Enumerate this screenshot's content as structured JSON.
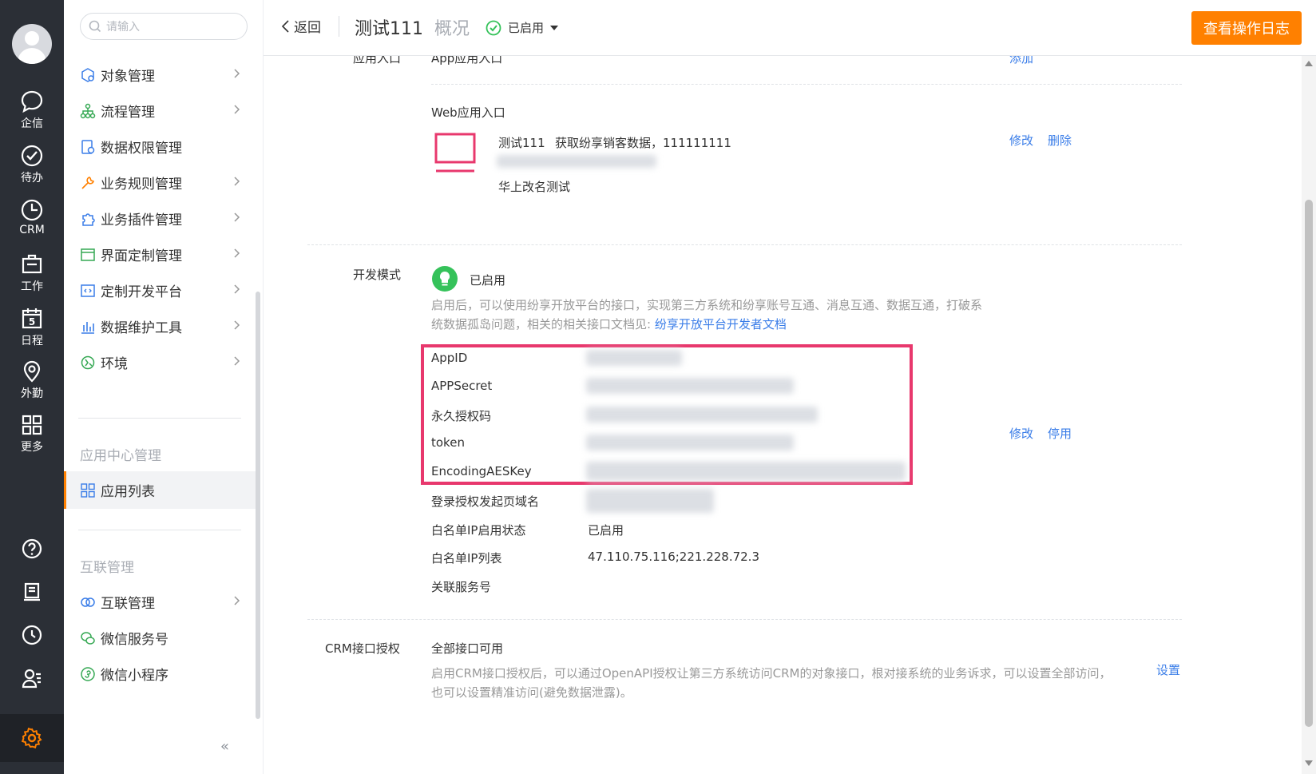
{
  "rail": {
    "items": [
      {
        "label": "企信",
        "icon": "chat-icon"
      },
      {
        "label": "待办",
        "icon": "check-circle-icon"
      },
      {
        "label": "CRM",
        "icon": "clock-pie-icon"
      },
      {
        "label": "工作",
        "icon": "briefcase-icon"
      },
      {
        "label": "日程",
        "icon": "calendar-icon",
        "day": "5"
      },
      {
        "label": "外勤",
        "icon": "location-icon"
      },
      {
        "label": "更多",
        "icon": "grid-icon"
      }
    ],
    "bottom_icons": [
      "help-icon",
      "document-icon",
      "history-icon",
      "contacts-icon",
      "settings-icon"
    ]
  },
  "sidebar": {
    "search_placeholder": "请输入",
    "items": [
      {
        "label": "对象管理",
        "icon": "object-icon"
      },
      {
        "label": "流程管理",
        "icon": "flow-icon"
      },
      {
        "label": "数据权限管理",
        "icon": "data-permission-icon"
      },
      {
        "label": "业务规则管理",
        "icon": "rule-icon"
      },
      {
        "label": "业务插件管理",
        "icon": "plugin-icon"
      },
      {
        "label": "界面定制管理",
        "icon": "layout-icon"
      },
      {
        "label": "定制开发平台",
        "icon": "code-icon"
      },
      {
        "label": "数据维护工具",
        "icon": "bar-chart-icon"
      },
      {
        "label": "环境",
        "icon": "environment-icon"
      }
    ],
    "group_app": "应用中心管理",
    "app_list": "应用列表",
    "group_interconnect": "互联管理",
    "interconnect_items": [
      {
        "label": "互联管理",
        "icon": "link-icon"
      },
      {
        "label": "微信服务号",
        "icon": "wechat-icon"
      },
      {
        "label": "微信小程序",
        "icon": "mini-program-icon"
      }
    ],
    "collapse": "«"
  },
  "topbar": {
    "back": "返回",
    "app_name": "测试111",
    "overview": "概况",
    "status": "已启用",
    "log_button": "查看操作日志"
  },
  "entry": {
    "label": "应用入口",
    "app_entry": "App应用入口",
    "add": "添加",
    "web_entry": "Web应用入口",
    "web_name": "测试111",
    "web_desc": "获取纷享销客数据，111111111",
    "web_sub": "华上改名测试",
    "edit": "修改",
    "delete": "删除"
  },
  "dev_mode": {
    "label": "开发模式",
    "status": "已启用",
    "desc": "启用后，可以使用纷享开放平台的接口，实现第三方系统和纷享账号互通、消息互通、数据互通，打破系统数据孤岛问题，相关的相关接口文档见: ",
    "doc_link": "纷享开放平台开发者文档",
    "fields": [
      "AppID",
      "APPSecret",
      "永久授权码",
      "token",
      "EncodingAESKey",
      "登录授权发起页域名",
      "白名单IP启用状态",
      "白名单IP列表",
      "关联服务号"
    ],
    "ip_status": "已启用",
    "ip_list": "47.110.75.116;221.228.72.3",
    "edit": "修改",
    "disable": "停用"
  },
  "crm": {
    "label": "CRM接口授权",
    "title": "全部接口可用",
    "desc": "启用CRM接口授权后，可以通过OpenAPI授权让第三方系统访问CRM的对象接口，根对接系统的业务诉求，可以设置全部访问，也可以设置精准访问(避免数据泄露)。",
    "setting": "设置"
  },
  "colors": {
    "accent": "#ff8000",
    "link": "#3a7de8",
    "highlight": "#e8386d",
    "success": "#35c25a",
    "rail": "#2b2f36"
  }
}
